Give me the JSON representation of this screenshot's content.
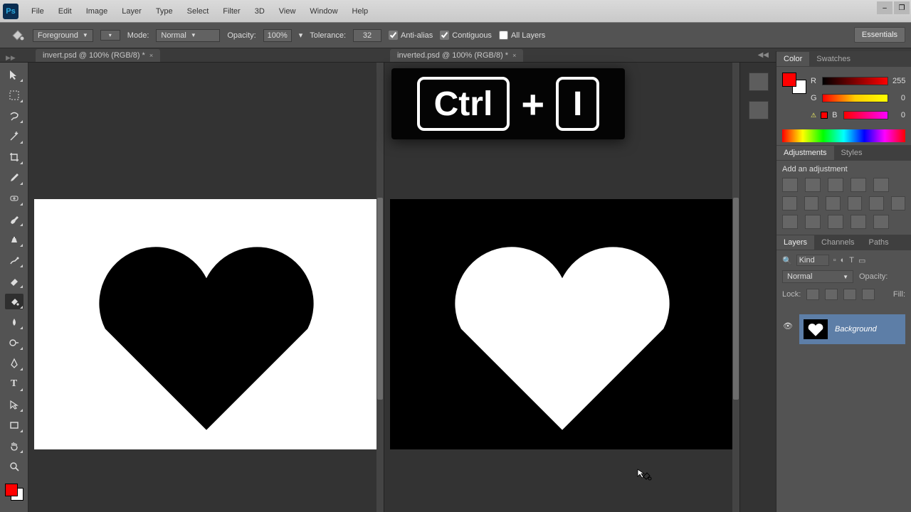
{
  "menu": [
    "File",
    "Edit",
    "Image",
    "Layer",
    "Type",
    "Select",
    "Filter",
    "3D",
    "View",
    "Window",
    "Help"
  ],
  "window_controls": {
    "min": "–",
    "restore": "❐",
    "close": "×"
  },
  "optionbar": {
    "fill_source": "Foreground",
    "mode_label": "Mode:",
    "mode_value": "Normal",
    "opacity_label": "Opacity:",
    "opacity_value": "100%",
    "tolerance_label": "Tolerance:",
    "tolerance_value": "32",
    "antialias": "Anti-alias",
    "contiguous": "Contiguous",
    "all_layers": "All Layers",
    "antialias_checked": true,
    "contiguous_checked": true,
    "all_layers_checked": false
  },
  "essentials": "Essentials",
  "tabs": {
    "left": "invert.psd @ 100% (RGB/8) *",
    "right": "inverted.psd @ 100% (RGB/8) *"
  },
  "shortcut": {
    "key1": "Ctrl",
    "plus": "+",
    "key2": "I"
  },
  "panels": {
    "color_tab": "Color",
    "swatches_tab": "Swatches",
    "rgb": {
      "R": "R",
      "G": "G",
      "B": "B",
      "r_val": "255",
      "g_val": "0",
      "b_val": "0"
    },
    "adjust_tab": "Adjustments",
    "styles_tab": "Styles",
    "adjust_hint": "Add an adjustment",
    "layers_tab": "Layers",
    "channels_tab": "Channels",
    "paths_tab": "Paths",
    "kind_label": "Kind",
    "blend_mode": "Normal",
    "opacity_label": "Opacity:",
    "lock_label": "Lock:",
    "fill_label": "Fill:",
    "layer_name": "Background"
  },
  "colors": {
    "foreground": "#ff0000",
    "background": "#ffffff"
  }
}
